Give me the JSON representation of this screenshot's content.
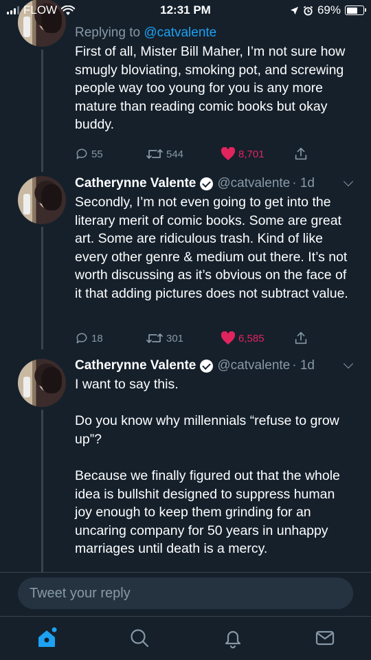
{
  "status_bar": {
    "carrier": "FLOW",
    "time": "12:31 PM",
    "battery": "69%",
    "battery_level": 0.69,
    "icons": [
      "signal-icon",
      "wifi-icon",
      "location-icon",
      "alarm-icon",
      "battery-icon"
    ]
  },
  "tweets": [
    {
      "replying_prefix": "Replying to",
      "replying_to": "@catvalente",
      "text": "First of all, Mister Bill Maher, I’m not sure how smugly bloviating, smoking pot, and screwing people way too young for you is any more mature than reading comic books but okay buddy.",
      "replies": "55",
      "retweets": "544",
      "likes": "8,701"
    },
    {
      "name": "Catherynne Valente",
      "handle": "@catvalente",
      "time": "· 1d",
      "text": "Secondly, I’m not even going to get into the literary merit of comic books. Some are great art. Some are ridiculous trash. Kind of like every other genre & medium out there. It’s not worth discussing as it’s obvious on the face of it that adding pictures does not subtract value.",
      "replies": "18",
      "retweets": "301",
      "likes": "6,585"
    },
    {
      "name": "Catherynne Valente",
      "handle": "@catvalente",
      "time": "· 1d",
      "text": "I want to say this.\n\nDo you know why millennials “refuse to grow up”?\n\nBecause we finally figured out that the whole idea is bullshit designed to suppress human joy enough to keep them grinding for an uncaring company for 50 years in unhappy marriages until death is a mercy."
    }
  ],
  "compose": {
    "placeholder": "Tweet your reply"
  },
  "tabbar": {
    "tabs": [
      "home-icon",
      "search-icon",
      "notifications-icon",
      "messages-icon"
    ],
    "active": "home-icon"
  },
  "colors": {
    "background": "#15202b",
    "accent": "#1da1f2",
    "like": "#e0245e",
    "secondary_text": "#8899a6",
    "divider": "#38444d"
  }
}
